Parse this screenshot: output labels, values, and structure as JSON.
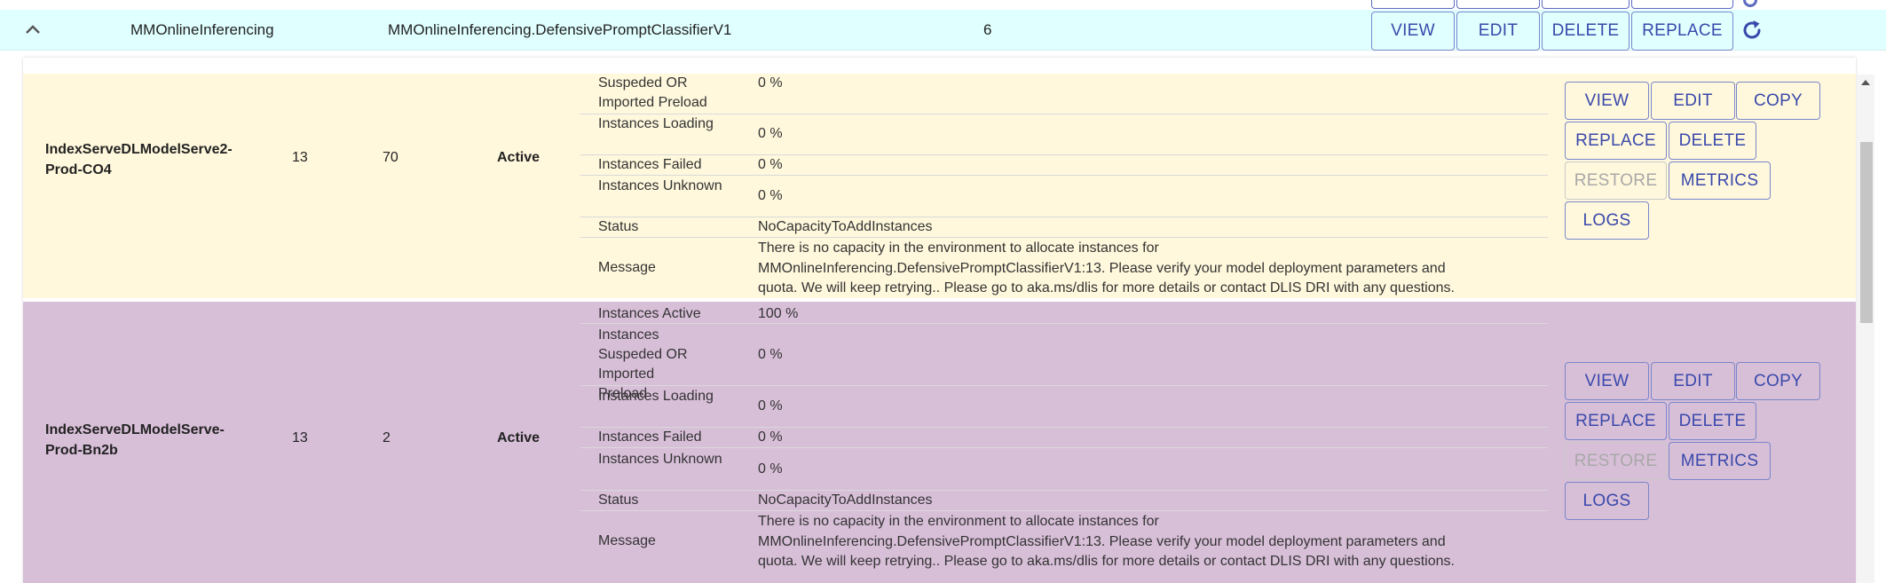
{
  "header": {
    "service": "MMOnlineInferencing",
    "model": "MMOnlineInferencing.DefensivePromptClassifierV1",
    "count": "6",
    "buttons": {
      "view": "VIEW",
      "edit": "EDIT",
      "delete": "DELETE",
      "replace": "REPLACE"
    }
  },
  "buttons": {
    "view": "VIEW",
    "edit": "EDIT",
    "copy": "COPY",
    "replace": "REPLACE",
    "delete": "DELETE",
    "restore": "RESTORE",
    "metrics": "METRICS",
    "logs": "LOGS"
  },
  "deployments": [
    {
      "name": "IndexServeDLModelServe2-Prod-CO4",
      "version": "13",
      "instances": "70",
      "status": "Active",
      "details": [
        {
          "label": "Suspeded OR Imported Preload",
          "value": "0 %"
        },
        {
          "label": "Instances Loading",
          "value": "0 %"
        },
        {
          "label": "Instances Failed",
          "value": "0 %"
        },
        {
          "label": "Instances Unknown",
          "value": "0 %"
        },
        {
          "label": "Status",
          "value": "NoCapacityToAddInstances"
        },
        {
          "label": "Message",
          "value": "There is no capacity in the environment to allocate instances for MMOnlineInferencing.DefensivePromptClassifierV1:13. Please verify your model deployment parameters and quota. We will keep retrying.. Please go to aka.ms/dlis for more details or contact DLIS DRI with any questions."
        }
      ]
    },
    {
      "name": "IndexServeDLModelServe-Prod-Bn2b",
      "version": "13",
      "instances": "2",
      "status": "Active",
      "details": [
        {
          "label": "Instances Active",
          "value": "100 %"
        },
        {
          "label": "Instances Suspeded OR Imported Preload",
          "value": "0 %"
        },
        {
          "label": "Instances Loading",
          "value": "0 %"
        },
        {
          "label": "Instances Failed",
          "value": "0 %"
        },
        {
          "label": "Instances Unknown",
          "value": "0 %"
        },
        {
          "label": "Status",
          "value": "NoCapacityToAddInstances"
        },
        {
          "label": "Message",
          "value": "There is no capacity in the environment to allocate instances for MMOnlineInferencing.DefensivePromptClassifierV1:13. Please verify your model deployment parameters and quota. We will keep retrying.. Please go to aka.ms/dlis for more details or contact DLIS DRI with any questions."
        }
      ]
    }
  ]
}
